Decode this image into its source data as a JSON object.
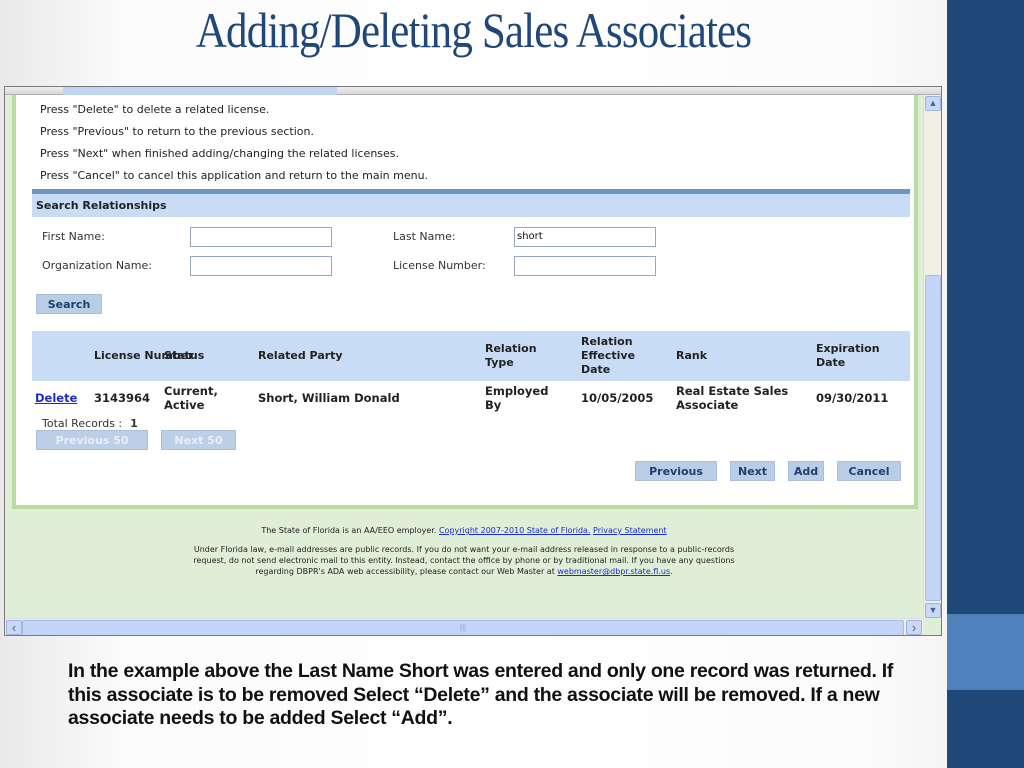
{
  "slide": {
    "title": "Adding/Deleting Sales Associates",
    "caption": "In the example above the Last Name Short was entered and only one record was returned. If this associate is to be removed Select “Delete” and the associate will be removed. If a new associate needs to be added Select “Add”.",
    "colors": {
      "title": "#1f4778",
      "sidebar": "#1f4778",
      "sidebar_accent": "#4f81bd"
    }
  },
  "app": {
    "instructions": [
      "Press \"Delete\" to delete a related license.",
      "Press \"Previous\" to return to the previous section.",
      "Press \"Next\" when finished adding/changing the related licenses.",
      "Press \"Cancel\" to cancel this application and return to the main menu."
    ],
    "search": {
      "heading": "Search Relationships",
      "first_name_label": "First Name:",
      "first_name_value": "",
      "last_name_label": "Last Name:",
      "last_name_value": "short",
      "org_name_label": "Organization Name:",
      "org_name_value": "",
      "license_number_label": "License Number:",
      "license_number_value": "",
      "search_button": "Search"
    },
    "table": {
      "headers": [
        "",
        "License Number",
        "Status",
        "Related Party",
        "Relation Type",
        "Relation Effective Date",
        "Rank",
        "Expiration Date"
      ],
      "rows": [
        {
          "action": "Delete",
          "license_number": "3143964",
          "status": "Current, Active",
          "related_party": "Short, William Donald",
          "relation_type": "Employed By",
          "effective_date": "10/05/2005",
          "rank": "Real Estate Sales Associate",
          "expiration_date": "09/30/2011"
        }
      ],
      "total_label": "Total Records :",
      "total_value": "1",
      "prev50": "Previous 50",
      "next50": "Next 50"
    },
    "nav_buttons": {
      "previous": "Previous",
      "next": "Next",
      "add": "Add",
      "cancel": "Cancel"
    },
    "footer": {
      "line1_text": "The State of Florida is an AA/EEO employer.",
      "copyright_link": "Copyright 2007-2010 State of Florida.",
      "privacy_link": "Privacy Statement",
      "notice": "Under Florida law, e-mail addresses are public records. If you do not want your e-mail address released in response to a public-records request, do not send electronic mail to this entity. Instead, contact the office by phone or by traditional mail. If you have any questions regarding DBPR's ADA web accessibility, please contact our Web Master at",
      "webmaster_link": "webmaster@dbpr.state.fl.us",
      "period": "."
    },
    "icons": {
      "scroll_up": "▲",
      "scroll_down": "▼",
      "scroll_left": "‹",
      "scroll_right": "›",
      "grip": "|||"
    }
  }
}
